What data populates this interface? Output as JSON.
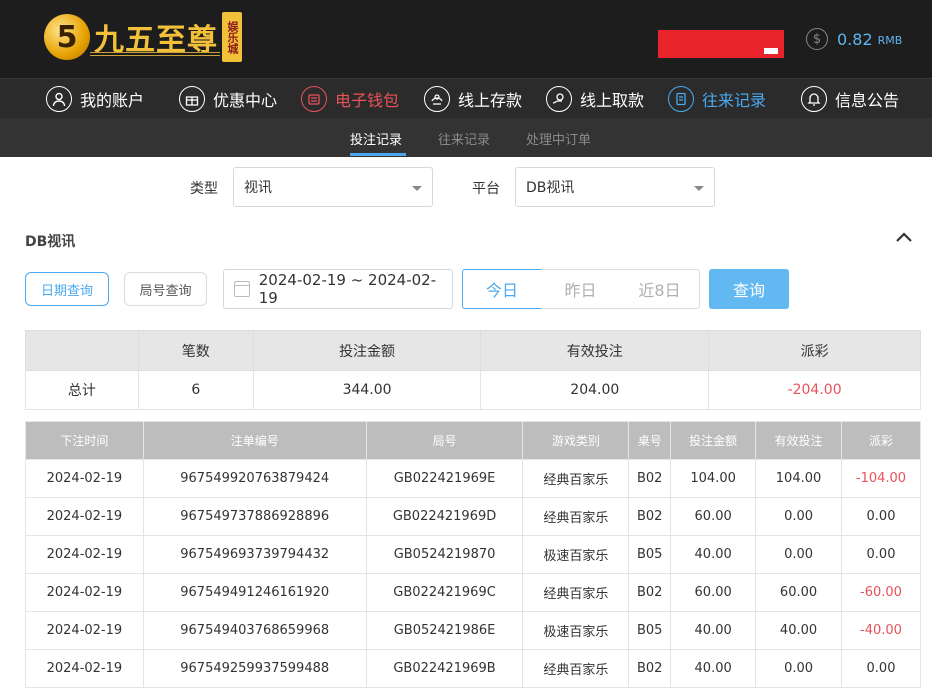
{
  "header": {
    "logo_numeral": "5",
    "logo_text": "九五至尊",
    "logo_badge": "娱乐城",
    "balance_icon": "dollar-coin-icon",
    "balance_value": "0.82",
    "balance_unit": "RMB"
  },
  "nav": {
    "items": [
      {
        "label": "我的账户",
        "icon": "user-icon"
      },
      {
        "label": "优惠中心",
        "icon": "gift-icon"
      },
      {
        "label": "电子钱包",
        "icon": "wallet-icon"
      },
      {
        "label": "线上存款",
        "icon": "deposit-icon"
      },
      {
        "label": "线上取款",
        "icon": "withdraw-icon"
      },
      {
        "label": "往来记录",
        "icon": "records-icon"
      },
      {
        "label": "信息公告",
        "icon": "bell-icon"
      }
    ],
    "colors": {
      "default": "#ffffff",
      "wallet": "#e8525a",
      "records": "#4aa8ee"
    }
  },
  "subtabs": [
    "投注记录",
    "往来记录",
    "处理中订单"
  ],
  "filters": {
    "type_label": "类型",
    "type_value": "视讯",
    "platform_label": "平台",
    "platform_value": "DB视讯"
  },
  "section": {
    "title": "DB视讯"
  },
  "query": {
    "mode_date": "日期查询",
    "mode_round": "局号查询",
    "date_range": "2024-02-19 ~ 2024-02-19",
    "today": "今日",
    "yesterday": "昨日",
    "last8": "近8日",
    "submit": "查询"
  },
  "summary": {
    "headers": [
      "",
      "笔数",
      "投注金额",
      "有效投注",
      "派彩"
    ],
    "row": {
      "label": "总计",
      "count": "6",
      "bet": "344.00",
      "valid": "204.00",
      "payout": "-204.00"
    }
  },
  "table": {
    "headers": [
      "下注时间",
      "注单编号",
      "局号",
      "游戏类别",
      "桌号",
      "投注金额",
      "有效投注",
      "派彩"
    ],
    "rows": [
      [
        "2024-02-19",
        "967549920763879424",
        "GB022421969E",
        "经典百家乐",
        "B02",
        "104.00",
        "104.00",
        "-104.00"
      ],
      [
        "2024-02-19",
        "967549737886928896",
        "GB022421969D",
        "经典百家乐",
        "B02",
        "60.00",
        "0.00",
        "0.00"
      ],
      [
        "2024-02-19",
        "967549693739794432",
        "GB0524219870",
        "极速百家乐",
        "B05",
        "40.00",
        "0.00",
        "0.00"
      ],
      [
        "2024-02-19",
        "967549491246161920",
        "GB022421969C",
        "经典百家乐",
        "B02",
        "60.00",
        "60.00",
        "-60.00"
      ],
      [
        "2024-02-19",
        "967549403768659968",
        "GB052421986E",
        "极速百家乐",
        "B05",
        "40.00",
        "40.00",
        "-40.00"
      ],
      [
        "2024-02-19",
        "967549259937599488",
        "GB022421969B",
        "经典百家乐",
        "B02",
        "40.00",
        "0.00",
        "0.00"
      ]
    ]
  }
}
